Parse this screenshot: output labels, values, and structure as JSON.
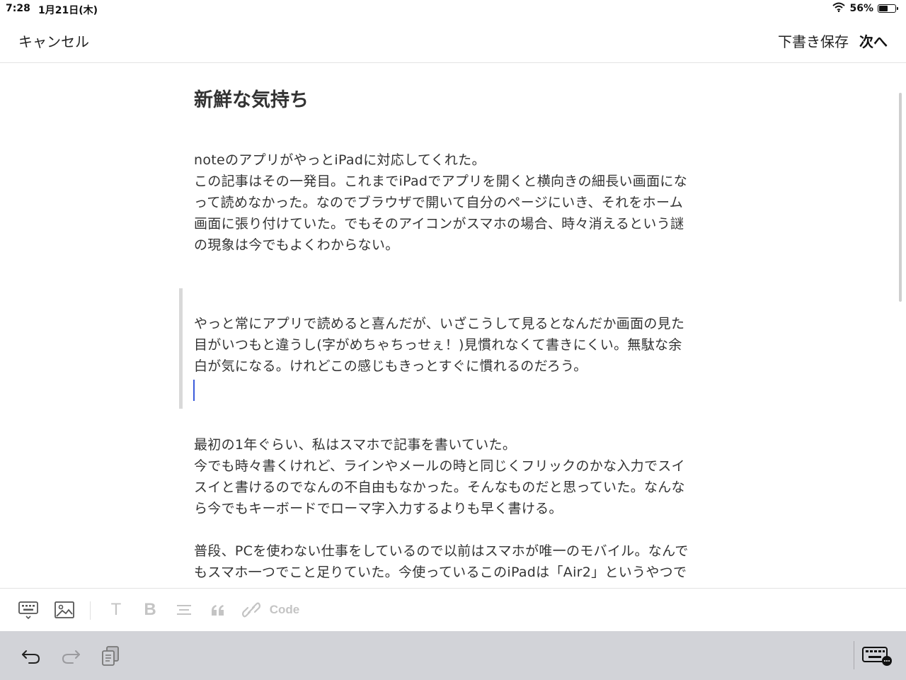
{
  "status": {
    "time": "7:28",
    "date": "1月21日(木)",
    "battery": "56%",
    "battery_level": 0.56
  },
  "nav": {
    "cancel": "キャンセル",
    "save_draft": "下書き保存",
    "next": "次へ"
  },
  "article": {
    "title": "新鮮な気持ち",
    "p1": [
      "noteのアプリがやっとiPadに対応してくれた。",
      "この記事はその一発目。これまでiPadでアプリを開くと横向きの細長い画面にな",
      "って読めなかった。なのでブラウザで開いて自分のページにいき、それをホーム",
      "画面に張り付けていた。でもそのアイコンがスマホの場合、時々消えるという謎",
      "の現象は今でもよくわからない。"
    ],
    "quote": [
      "やっと常にアプリで読めると喜んだが、いざこうして見るとなんだか画面の見た",
      "目がいつもと違うし(字がめちゃちっせぇ！)見慣れなくて書きにくい。無駄な余",
      "白が気になる。けれどこの感じもきっとすぐに慣れるのだろう。"
    ],
    "p2": [
      "最初の1年ぐらい、私はスマホで記事を書いていた。",
      "今でも時々書くけれど、ラインやメールの時と同じくフリックのかな入力でスイ",
      "スイと書けるのでなんの不自由もなかった。そんなものだと思っていた。なんな",
      "ら今でもキーボードでローマ字入力するよりも早く書ける。"
    ],
    "p3": [
      "普段、PCを使わない仕事をしているので以前はスマホが唯一のモバイル。なんで",
      "もスマホ一つでこと足りていた。今使っているこのiPadは「Air2」というやつで"
    ]
  },
  "toolbar": {
    "keyboard_icon": "keyboard-icon",
    "image_icon": "image-icon",
    "heading_label": "T",
    "bold_label": "B",
    "code_label": "Code"
  },
  "colors": {
    "accent_cursor": "#3b5bdb",
    "text": "#333333",
    "disabled": "#c4c4c4",
    "keyboard_bar": "#d2d3d8"
  }
}
